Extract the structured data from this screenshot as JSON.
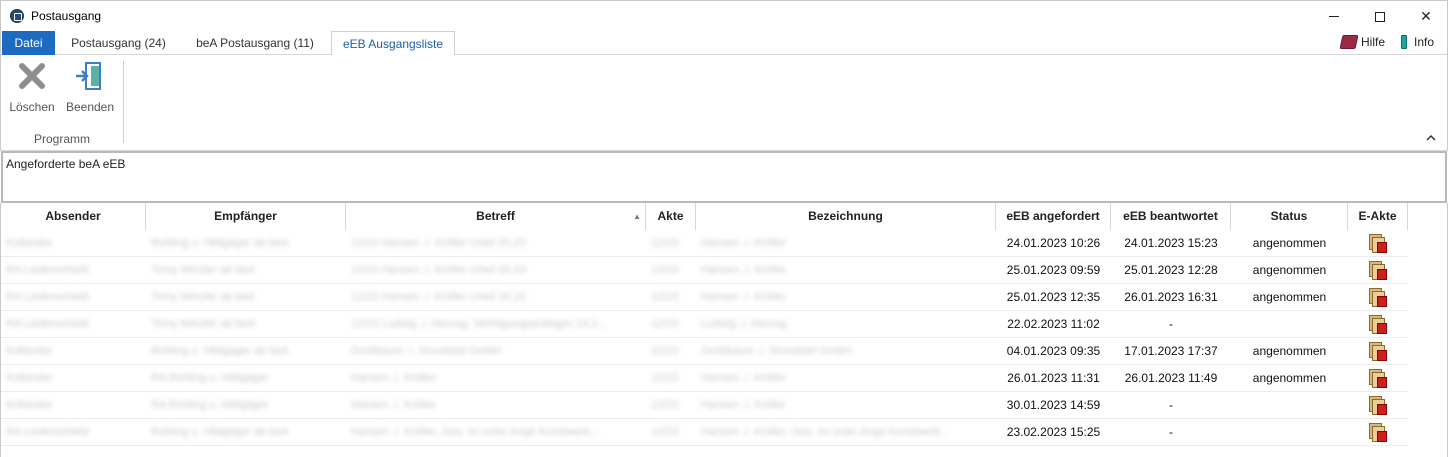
{
  "window": {
    "title": "Postausgang"
  },
  "tabs": [
    {
      "label": "Datei"
    },
    {
      "label": "Postausgang (24)"
    },
    {
      "label": "beA Postausgang (11)"
    },
    {
      "label": "eEB Ausgangsliste"
    }
  ],
  "help": {
    "hilfe_label": "Hilfe",
    "info_label": "Info"
  },
  "ribbon": {
    "delete_label": "Löschen",
    "exit_label": "Beenden",
    "group_label": "Programm",
    "delete_icon": "x-icon",
    "exit_icon": "exit-door-icon"
  },
  "description": "Angeforderte beA eEB",
  "grid": {
    "columns": [
      "Absender",
      "Empfänger",
      "Betreff",
      "Akte",
      "Bezeichnung",
      "eEB angefordert",
      "eEB beantwortet",
      "Status",
      "E-Akte"
    ],
    "sorted_column": "Betreff",
    "rows": [
      {
        "absender": "Kollander",
        "empfaenger": "Rohling u. Hildgäger ab beA",
        "betreff": "12/23 Hansen ./. Kröller Urteil 20.23",
        "akte": "12/23",
        "bezeichnung": "Hansen ./. Kröller",
        "angefordert": "24.01.2023 10:26",
        "beantwortet": "24.01.2023 15:23",
        "status": "angenommen"
      },
      {
        "absender": "RA Leiderschield",
        "empfaenger": "Tinny Winzler ab beA",
        "betreff": "12/23 Hansen ./. Kröller Urteil 20.23",
        "akte": "12/23",
        "bezeichnung": "Hansen ./. Kröller",
        "angefordert": "25.01.2023 09:59",
        "beantwortet": "25.01.2023 12:28",
        "status": "angenommen"
      },
      {
        "absender": "RA Leiderschield",
        "empfaenger": "Tinny Winzler ab beA",
        "betreff": "12/23 Hansen ./. Kröller Urteil 20.23",
        "akte": "12/23",
        "bezeichnung": "Hansen ./. Kröller",
        "angefordert": "25.01.2023 12:35",
        "beantwortet": "26.01.2023 16:31",
        "status": "angenommen"
      },
      {
        "absender": "RA Leiderschield",
        "empfaenger": "Tinny Winzler ab beA",
        "betreff": "12/23 Ludwig ./. Herzog, Verfolgungsanliegen 14.2...",
        "akte": "12/23",
        "bezeichnung": "Ludwig ./. Herzog",
        "angefordert": "22.02.2023 11:02",
        "beantwortet": "-",
        "status": ""
      },
      {
        "absender": "Kollander",
        "empfaenger": "Rohling u. Hildgäger ab beA",
        "betreff": "Großbaum ./. Grundstel GmbH",
        "akte": "21/23",
        "bezeichnung": "Großbaum ./. Grundstel GmbH",
        "angefordert": "04.01.2023 09:35",
        "beantwortet": "17.01.2023 17:37",
        "status": "angenommen"
      },
      {
        "absender": "Kollander",
        "empfaenger": "RA Rohling u. Hildgäger",
        "betreff": "Hansen ./. Kröller",
        "akte": "12/23",
        "bezeichnung": "Hansen ./. Kröller",
        "angefordert": "26.01.2023 11:31",
        "beantwortet": "26.01.2023 11:49",
        "status": "angenommen"
      },
      {
        "absender": "Kollander",
        "empfaenger": "RA Rohling u. Hildgäger",
        "betreff": "Hansen ./. Kröller",
        "akte": "12/23",
        "bezeichnung": "Hansen ./. Kröller",
        "angefordert": "30.01.2023 14:59",
        "beantwortet": "-",
        "status": ""
      },
      {
        "absender": "RA Leiderschield",
        "empfaenger": "Rohling u. Hildgäger ab beA",
        "betreff": "Hansen ./. Kröller, Ges. im unter Ange Kunstwerk...",
        "akte": "12/23",
        "bezeichnung": "Hansen ./. Kröller, Ges. im unter Ange Kunstwerk...",
        "angefordert": "23.02.2023 15:25",
        "beantwortet": "-",
        "status": ""
      }
    ]
  },
  "colors": {
    "accent": "#1d6bc1",
    "eakte_icon_red": "#cc1f1f"
  }
}
